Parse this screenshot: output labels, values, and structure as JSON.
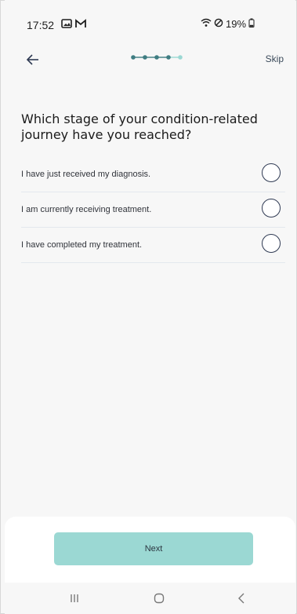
{
  "status_bar": {
    "time": "17:52",
    "left_icons": [
      "gallery-icon",
      "gmail-icon"
    ],
    "battery_text": "19%",
    "right_icons": [
      "wifi-icon",
      "do-not-disturb-icon",
      "battery-icon"
    ]
  },
  "header": {
    "back_icon": "arrow-left-icon",
    "progress": {
      "total_steps": 5,
      "current_step": 5
    },
    "skip_label": "Skip"
  },
  "question": {
    "text": "Which stage of your condition-related journey have you reached?"
  },
  "options": [
    {
      "label": "I have just received my diagnosis.",
      "selected": false
    },
    {
      "label": "I am currently receiving treatment.",
      "selected": false
    },
    {
      "label": "I have completed my treatment.",
      "selected": false
    }
  ],
  "footer": {
    "next_label": "Next"
  },
  "nav_bar": {
    "items": [
      "recents-icon",
      "home-icon",
      "back-icon"
    ]
  },
  "colors": {
    "background": "#f7f7f7",
    "accent": "#9bd8d3",
    "progress_active": "#3f7d82",
    "progress_inactive": "#9bd8d3",
    "radio_border": "#2f3a53"
  }
}
